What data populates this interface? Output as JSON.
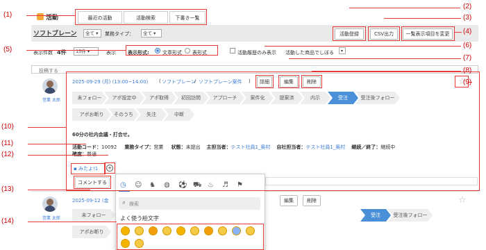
{
  "header": {
    "title": "活動",
    "tabs": [
      "最近の活動",
      "活動検索",
      "下書き一覧"
    ]
  },
  "toolbar": {
    "company": "ソフトブレーン",
    "all_select": "全て",
    "type_label": "業務タイプ：",
    "type_select": "全て",
    "register_button": "活動登録",
    "csv_button": "CSV出力",
    "columns_button": "一覧表示項目を変更"
  },
  "filters": {
    "display_count_label": "表示件数",
    "display_count_value": "4件",
    "per_page_select": "15件",
    "per_page_suffix": "表示",
    "format_label": "表示形式:",
    "format_sentence": "文章形式",
    "format_table": "表形式",
    "history_only": "活動履歴のみ表示",
    "narrow_label": "活動した商品でしぼる"
  },
  "post_placeholder": "投稿する",
  "activity1": {
    "user_name": "営業 太郎",
    "date": "2025-09-29 (月) (13:00~14:00)",
    "company_link": "ソフトブレーン",
    "project_link": "ソフトブレーン案件",
    "detail_button": "詳細",
    "edit_button": "編集",
    "delete_button": "削除",
    "steps_row1": [
      "未フォロー",
      "アポ設定中",
      "アポ取得",
      "初回訪問",
      "アプローチ",
      "案件化",
      "提案済",
      "内示",
      "受注",
      "受注後フォロー"
    ],
    "steps_row2": [
      "アポお断り",
      "そのうち",
      "失注",
      "中断"
    ],
    "active_step": "受注",
    "title": "60分の社内会議・打合せ。",
    "code_label": "活動コード：",
    "code_value": "10092",
    "biz_type_label": "業務タイプ：",
    "biz_type_value": "営業",
    "status_label": "状態：",
    "status_value": "未提出",
    "main_owner_label": "主担当者：",
    "main_owner_value": "テスト社員1_奥村",
    "self_owner_label": "自社担当者：",
    "self_owner_value": "テスト社員1_奥村",
    "continue_label": "継続／終了：",
    "continue_value": "継続中",
    "confirm_label": "確度：",
    "confirm_value": "普通",
    "reaction_label": "みたよ!",
    "reaction_count": "1",
    "comment_button": "コメントする"
  },
  "activity2": {
    "user_name": "営業 太郎",
    "date": "2025-09-12 (金",
    "edit_button": "編集",
    "delete_button": "削除",
    "steps_row1": [
      "未フォロー",
      "受注",
      "受注後フォロー"
    ],
    "steps_row2": [
      "アポお断り"
    ],
    "active_step": "受注"
  },
  "emoji_panel": {
    "search_placeholder": "検索",
    "section_title": "よく使う絵文字",
    "category_icons": [
      "clock-icon",
      "smile-icon",
      "animal-icon",
      "food-icon",
      "ball-icon",
      "car-icon",
      "bulb-icon",
      "symbol-icon",
      "flag-icon"
    ],
    "emojis": [
      "thumbs-up",
      "smile",
      "grin",
      "heart-eyes",
      "laugh",
      "wink",
      "kiss",
      "sunglasses",
      "scream",
      "party",
      "sad",
      "joy"
    ]
  },
  "callouts": [
    "(1)",
    "(2)",
    "(3)",
    "(4)",
    "(5)",
    "(6)",
    "(7)",
    "(8)",
    "(9)",
    "(10)",
    "(11)",
    "(12)",
    "(13)",
    "(14)"
  ],
  "colors": {
    "accent": "#4a90d9",
    "callout": "#e53935",
    "toolbar_bg": "#eaeaea"
  }
}
